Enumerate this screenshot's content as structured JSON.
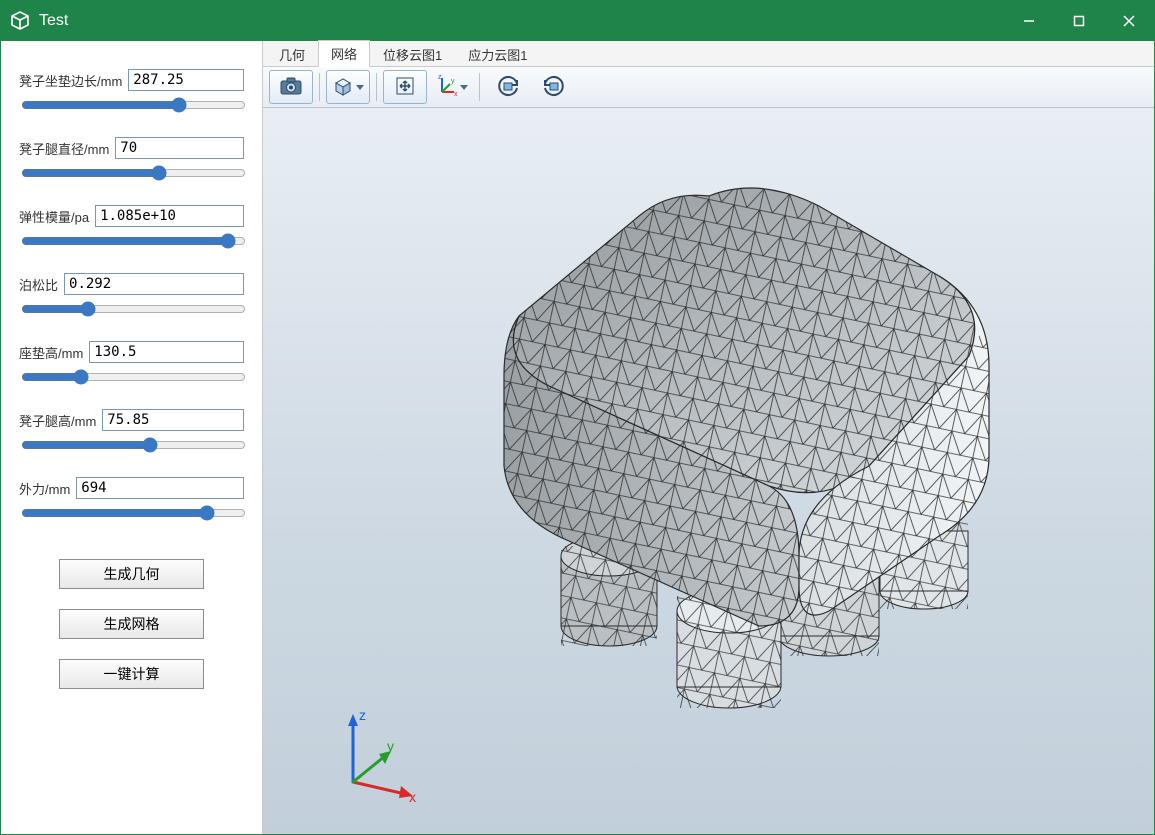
{
  "window": {
    "title": "Test"
  },
  "window_controls": {
    "minimize": "minimize",
    "maximize": "maximize",
    "close": "close"
  },
  "tabs": [
    {
      "label": "几何",
      "active": false
    },
    {
      "label": "网络",
      "active": true
    },
    {
      "label": "位移云图1",
      "active": false
    },
    {
      "label": "应力云图1",
      "active": false
    }
  ],
  "toolbar": {
    "screenshot": "screenshot",
    "view_cube": "view-cube",
    "fit_view": "fit-view",
    "axis_widget": "axis-triad",
    "rotate_ccw": "rotate-ccw",
    "rotate_cw": "rotate-cw"
  },
  "sidebar": {
    "params": [
      {
        "key": "seat_edge",
        "label": "凳子坐垫边长/mm",
        "value": "287.25",
        "slider_pct": 72
      },
      {
        "key": "leg_diameter",
        "label": "凳子腿直径/mm",
        "value": "70",
        "slider_pct": 62
      },
      {
        "key": "elastic_modulus",
        "label": "弹性模量/pa",
        "value": "1.085e+10",
        "slider_pct": 95
      },
      {
        "key": "poisson_ratio",
        "label": "泊松比",
        "value": "0.292",
        "slider_pct": 28
      },
      {
        "key": "seat_height",
        "label": "座垫高/mm",
        "value": "130.5",
        "slider_pct": 25
      },
      {
        "key": "leg_height",
        "label": "凳子腿高/mm",
        "value": "75.85",
        "slider_pct": 58
      },
      {
        "key": "force",
        "label": "外力/mm",
        "value": "694",
        "slider_pct": 85
      }
    ],
    "buttons": {
      "generate_geometry": "生成几何",
      "generate_mesh": "生成网格",
      "compute": "一键计算"
    }
  },
  "viewport": {
    "triad_labels": {
      "x": "x",
      "y": "y",
      "z": "z"
    },
    "mesh_description": "3D triangulated surface mesh of a rounded square stool with four cylindrical legs"
  }
}
